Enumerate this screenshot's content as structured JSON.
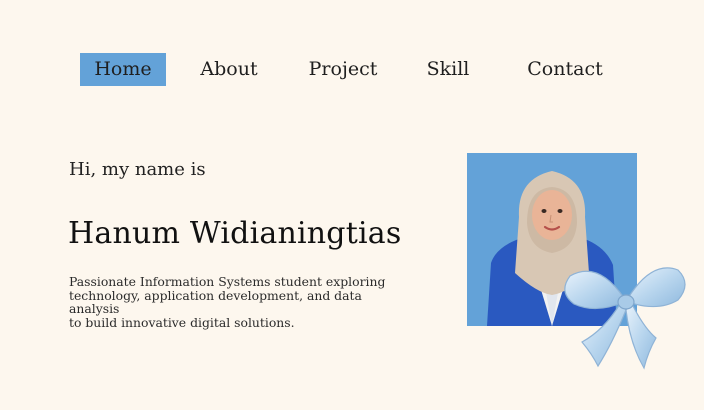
{
  "nav": {
    "items": [
      {
        "label": "Home",
        "active": true
      },
      {
        "label": "About"
      },
      {
        "label": "Project"
      },
      {
        "label": "Skill"
      },
      {
        "label": "Contact"
      }
    ]
  },
  "hero": {
    "greeting": "Hi, my name is",
    "name": "Hanum Widianingtias",
    "bio": "Passionate Information Systems student exploring\ntechnology, application development, and data analysis\nto build innovative digital solutions."
  },
  "colors": {
    "background": "#fdf7ee",
    "accent": "#63a2d8",
    "text": "#1f1f1f"
  },
  "icons": {
    "photo": "profile-photo",
    "decoration": "ribbon-bow-icon"
  }
}
